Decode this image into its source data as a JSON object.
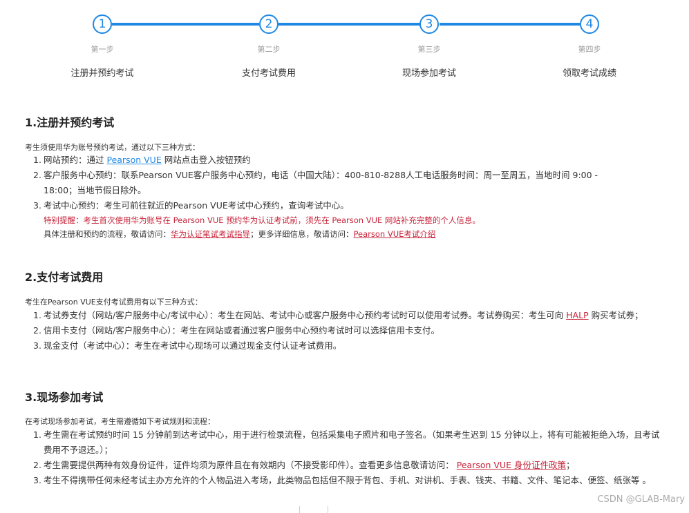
{
  "steps": [
    {
      "number": "1",
      "sub": "第一步",
      "title": "注册并预约考试"
    },
    {
      "number": "2",
      "sub": "第二步",
      "title": "支付考试费用"
    },
    {
      "number": "3",
      "sub": "第三步",
      "title": "现场参加考试"
    },
    {
      "number": "4",
      "sub": "第四步",
      "title": "领取考试成绩"
    }
  ],
  "colors": {
    "accent": "#1E88E5",
    "warning_red": "#C7243A"
  },
  "section1": {
    "heading": "1.注册并预约考试",
    "intro": "考生须使用华为账号预约考试，通过以下三种方式：",
    "items": [
      {
        "num": "1.",
        "before": "网站预约：通过 ",
        "link": "Pearson VUE",
        "after": " 网站点击登入按钮预约"
      },
      {
        "num": "2.",
        "text": "客户服务中心预约：联系Pearson VUE客户服务中心预约，电话（中国大陆）：400-810-8288人工电话服务时间：周一至周五，当地时间 9:00 - 18:00；当地节假日除外。"
      },
      {
        "num": "3.",
        "text": "考试中心预约：考生可前往就近的Pearson VUE考试中心预约，查询考试中心。"
      }
    ],
    "notice": "特别提醒：考生首次使用华为账号在 Pearson VUE 预约华为认证考试前，须先在 Pearson VUE 网站补充完整的个人信息。",
    "process_prefix": "具体注册和预约的流程，敬请访问：",
    "process_link1": "华为认证笔试考试指导",
    "process_middle": "；更多详细信息，敬请访问：",
    "process_link2": "Pearson VUE考试介绍"
  },
  "section2": {
    "heading": "2.支付考试费用",
    "intro": "考生在Pearson VUE支付考试费用有以下三种方式：",
    "items": [
      {
        "num": "1.",
        "before": "考试券支付（网站/客户服务中心/考试中心）：考生在网站、考试中心或客户服务中心预约考试时可以使用考试券。考试券购买：考生可向 ",
        "link": "HALP",
        "after": " 购买考试券；"
      },
      {
        "num": "2.",
        "text": "信用卡支付（网站/客户服务中心）：考生在网站或者通过客户服务中心预约考试时可以选择信用卡支付。"
      },
      {
        "num": "3.",
        "text": "现金支付（考试中心）：考生在考试中心现场可以通过现金支付认证考试费用。"
      }
    ]
  },
  "section3": {
    "heading": "3.现场参加考试",
    "intro": "在考试现场参加考试，考生需遵循如下考试规则和流程：",
    "items": [
      {
        "num": "1.",
        "text": "考生需在考试预约时间 15 分钟前到达考试中心，用于进行检录流程，包括采集电子照片和电子签名。（如果考生迟到 15 分钟以上，将有可能被拒绝入场，且考试费用不予退还。）；"
      },
      {
        "num": "2.",
        "before": "考生需要提供两种有效身份证件，证件均须为原件且在有效期内（不接受影印件）。查看更多信息敬请访问：  ",
        "link": "Pearson VUE 身份证件政策",
        "after": "；"
      },
      {
        "num": "3.",
        "text": "考生不得携带任何未经考试主办方允许的个人物品进入考场，此类物品包括但不限于背包、手机、对讲机、手表、钱夹、书籍、文件、笔记本、便签、纸张等 。"
      }
    ]
  },
  "watermark": "CSDN @GLAB-Mary"
}
